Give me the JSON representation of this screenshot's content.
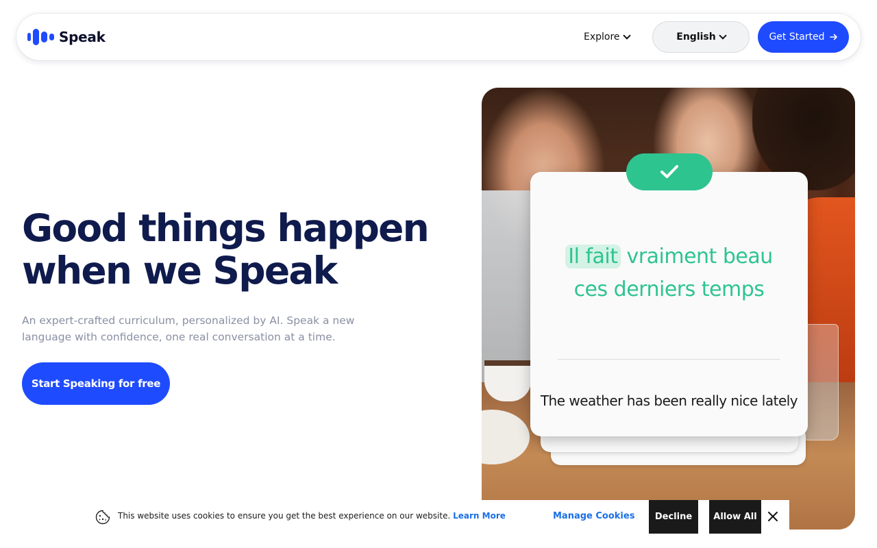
{
  "nav": {
    "brand": "Speak",
    "explore_label": "Explore",
    "language_label": "English",
    "cta_label": "Get Started",
    "brand_color": "#1f4bff"
  },
  "hero": {
    "title_line1": "Good things happen",
    "title_line2": "when we Speak",
    "subtitle": "An expert-crafted curriculum, personalized by AI. Speak a new language with confidence, one real conversation at a time.",
    "cta_label": "Start Speaking for free"
  },
  "card": {
    "phrase_highlight": "Il fait",
    "phrase_rest_line1": "vraiment beau",
    "phrase_line2": "ces derniers temps",
    "translation": "The weather has been really nice lately",
    "accent_color": "#2ec490"
  },
  "cookie": {
    "message": "This website uses cookies to ensure you get the best experience on our website.",
    "learn_more": "Learn More",
    "manage_label": "Manage Cookies",
    "decline_label": "Decline",
    "allow_label": "Allow All"
  }
}
